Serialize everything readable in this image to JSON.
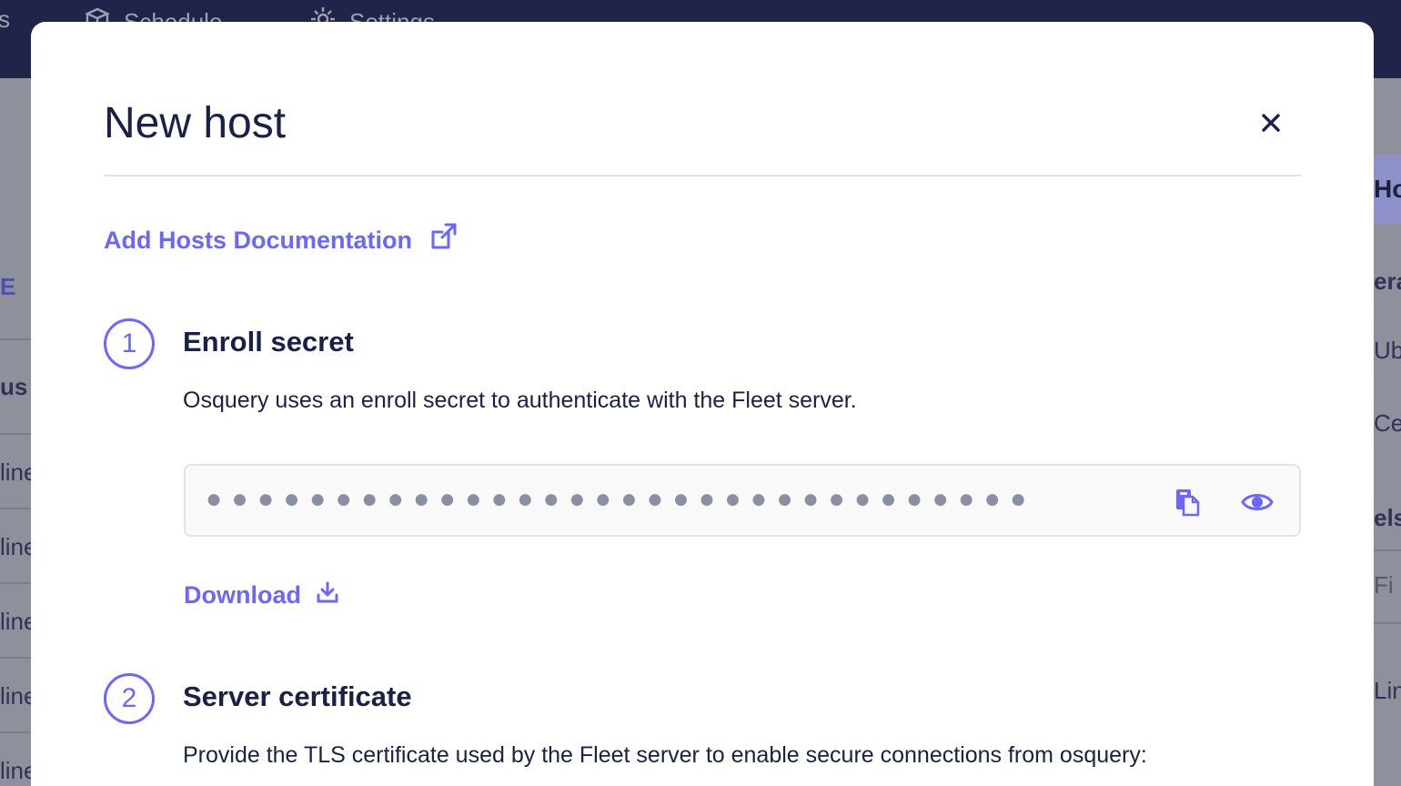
{
  "background": {
    "nav_items": [
      {
        "label": "s",
        "icon": "none"
      },
      {
        "label": "Schedule",
        "icon": "box-icon"
      },
      {
        "label": "Settings",
        "icon": "gear-icon"
      }
    ],
    "left_fragments": [
      "E",
      "us",
      "line",
      "line",
      "line",
      "line",
      "line"
    ],
    "right_fragments": [
      "Ho",
      "era",
      "Ub",
      "Ce",
      "els",
      "Fi",
      "Lin"
    ]
  },
  "modal": {
    "title": "New host",
    "close_icon": "close-icon",
    "doc_link": {
      "label": "Add Hosts Documentation",
      "icon": "external-link-icon"
    },
    "steps": [
      {
        "number": "1",
        "title": "Enroll secret",
        "description": "Osquery uses an enroll secret to authenticate with the Fleet server.",
        "secret_masked": "●●●●●●●●●●●●●●●●●●●●●●●●●●●●●●●●",
        "copy_icon": "copy-icon",
        "reveal_icon": "eye-icon",
        "download_label": "Download",
        "download_icon": "download-icon"
      },
      {
        "number": "2",
        "title": "Server certificate",
        "description": "Provide the TLS certificate used by the Fleet server to enable secure connections from osquery:"
      }
    ]
  },
  "colors": {
    "accent": "#6a67fe",
    "text": "#192147",
    "nav_bg": "#202449",
    "field_bg": "#f9f9f9",
    "border": "#e2e4ea"
  }
}
